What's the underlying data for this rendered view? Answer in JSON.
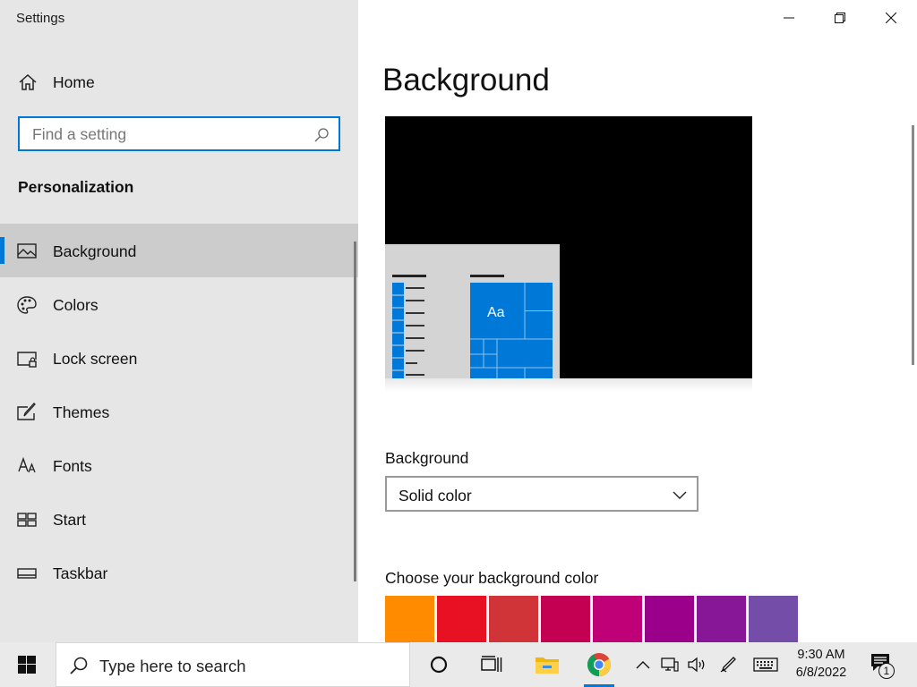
{
  "window": {
    "title": "Settings",
    "controls": [
      "minimize",
      "restore",
      "close"
    ]
  },
  "sidebar": {
    "home_label": "Home",
    "search_placeholder": "Find a setting",
    "section_title": "Personalization",
    "items": [
      {
        "label": "Background",
        "icon": "picture-icon",
        "active": true
      },
      {
        "label": "Colors",
        "icon": "palette-icon",
        "active": false
      },
      {
        "label": "Lock screen",
        "icon": "lock-screen-icon",
        "active": false
      },
      {
        "label": "Themes",
        "icon": "themes-brush-icon",
        "active": false
      },
      {
        "label": "Fonts",
        "icon": "fonts-icon",
        "active": false
      },
      {
        "label": "Start",
        "icon": "start-grid-icon",
        "active": false
      },
      {
        "label": "Taskbar",
        "icon": "taskbar-icon",
        "active": false
      }
    ]
  },
  "main": {
    "title": "Background",
    "preview": {
      "tile_text": "Aa",
      "background_color": "#000000",
      "accent": "#0078d7"
    },
    "background_label": "Background",
    "background_value": "Solid color",
    "color_label": "Choose your background color",
    "swatches": [
      "#ff8c00",
      "#e81123",
      "#d13438",
      "#c30052",
      "#bf0077",
      "#9a0089",
      "#881798",
      "#744da9"
    ]
  },
  "taskbar": {
    "search_placeholder": "Type here to search",
    "icons": [
      "windows-start-icon",
      "search-magnifier-icon",
      "cortana-circle-icon",
      "task-view-icon",
      "file-explorer-icon",
      "chrome-icon"
    ],
    "tray_icons": [
      "chevron-up-icon",
      "network-icon",
      "volume-icon",
      "pen-icon",
      "keyboard-icon"
    ],
    "time": "9:30 AM",
    "date": "6/8/2022",
    "notification_count": "1"
  },
  "colors": {
    "accent": "#0078d7",
    "sidebar_bg": "#e6e6e6",
    "active_item_bg": "#cccccc"
  }
}
